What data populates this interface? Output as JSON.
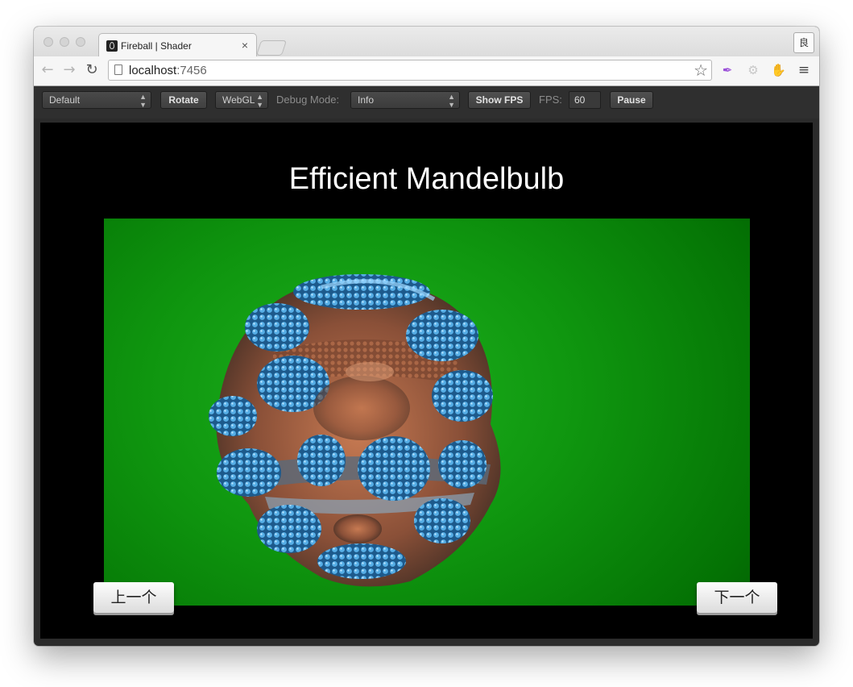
{
  "browser": {
    "tab_title": "Fireball | Shader",
    "tab_close": "×",
    "profile_label": "良",
    "url_host": "localhost",
    "url_port": ":7456"
  },
  "controls": {
    "preset_select": "Default",
    "rotate_label": "Rotate",
    "renderer_select": "WebGL",
    "debug_label": "Debug Mode:",
    "debug_select": "Info",
    "show_fps_label": "Show FPS",
    "fps_label": "FPS:",
    "fps_value": "60",
    "pause_label": "Pause"
  },
  "stage": {
    "title": "Efficient Mandelbulb",
    "prev_label": "上一个",
    "next_label": "下一个"
  },
  "icons": [
    "back-icon",
    "forward-icon",
    "reload-icon",
    "page-icon",
    "bookmark-star-icon",
    "feather-extension-icon",
    "gear-extension-icon",
    "evernote-extension-icon",
    "menu-icon"
  ],
  "colors": {
    "shader_background": "#0f960f",
    "fractal_blue": "#3a9ad6",
    "fractal_copper": "#b06a48"
  }
}
